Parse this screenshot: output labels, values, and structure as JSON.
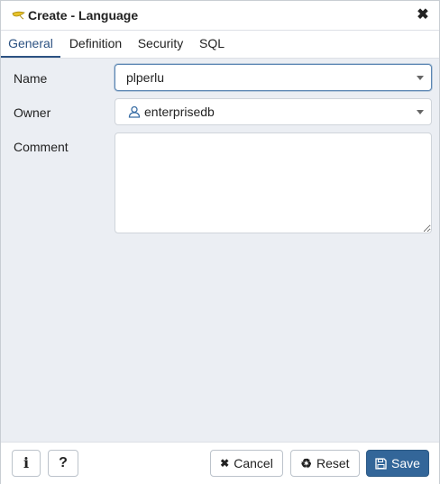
{
  "dialog": {
    "title": "Create - Language",
    "close_glyph": "✖"
  },
  "tabs": [
    {
      "label": "General",
      "active": true
    },
    {
      "label": "Definition",
      "active": false
    },
    {
      "label": "Security",
      "active": false
    },
    {
      "label": "SQL",
      "active": false
    }
  ],
  "form": {
    "name_label": "Name",
    "name_value": "plperlu",
    "owner_label": "Owner",
    "owner_value": "enterprisedb",
    "comment_label": "Comment",
    "comment_value": ""
  },
  "footer": {
    "info_glyph": "i",
    "help_glyph": "?",
    "cancel_label": "Cancel",
    "cancel_icon": "✖",
    "reset_label": "Reset",
    "reset_icon": "♻",
    "save_label": "Save"
  },
  "colors": {
    "accent": "#336699",
    "active_tab": "#2c5282",
    "background": "#ebeef3"
  },
  "icons": [
    "language-icon",
    "close-icon",
    "user-icon",
    "chevron-down-icon",
    "info-icon",
    "help-icon",
    "cancel-icon",
    "reset-icon",
    "save-icon"
  ]
}
